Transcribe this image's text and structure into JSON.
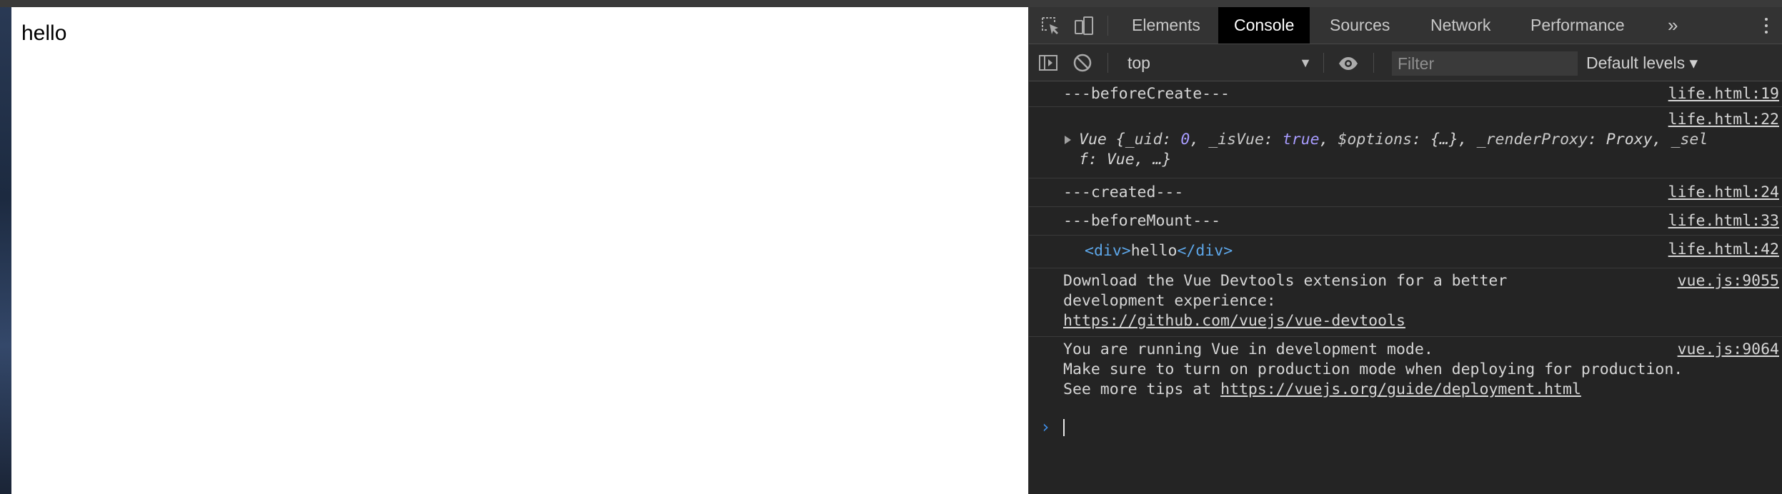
{
  "page": {
    "text": "hello"
  },
  "devtools": {
    "tabs": [
      {
        "label": "Elements"
      },
      {
        "label": "Console",
        "active": true
      },
      {
        "label": "Sources"
      },
      {
        "label": "Network"
      },
      {
        "label": "Performance"
      }
    ],
    "more_tabs_label": "»",
    "toolbar": {
      "context": "top",
      "filter_placeholder": "Filter",
      "levels_label": "Default levels ▾"
    },
    "console": {
      "messages": [
        {
          "text": "---beforeCreate---",
          "source": "life.html:19"
        },
        {
          "source": "life.html:22",
          "object_line1": "Vue {_uid: 0, _isVue: true, $options: {…}, _renderProxy: Proxy, _sel",
          "object_line2": "f: Vue, …}",
          "parts": {
            "class": "Vue {",
            "k1": "_uid",
            "v1": "0",
            "k2": "_isVue",
            "v2": "true",
            "k3": "$options",
            "v3": "{…}",
            "k4": "_renderProxy",
            "v4": "Proxy",
            "k5": "_sel",
            "tail": "f: Vue, …}"
          }
        },
        {
          "text": "---created---",
          "source": "life.html:24"
        },
        {
          "text": "---beforeMount---",
          "source": "life.html:33"
        },
        {
          "source": "life.html:42",
          "tag_open": "<div>",
          "tag_text": "hello",
          "tag_close": "</div>"
        },
        {
          "source": "vue.js:9055",
          "line1": "Download the Vue Devtools extension for a better",
          "line2": "development experience:",
          "link": "https://github.com/vuejs/vue-devtools"
        },
        {
          "source": "vue.js:9064",
          "line1": "You are running Vue in development mode.",
          "line2": "Make sure to turn on production mode when deploying for production.",
          "line3_prefix": "See more tips at ",
          "link": "https://vuejs.org/guide/deployment.html"
        }
      ],
      "prompt_symbol": "›"
    }
  },
  "colors": {
    "devtools_bg": "#242424",
    "tabbar_bg": "#333333",
    "active_tab_bg": "#000000",
    "tag_blue": "#5da6e8",
    "value_purple": "#a89cff"
  }
}
